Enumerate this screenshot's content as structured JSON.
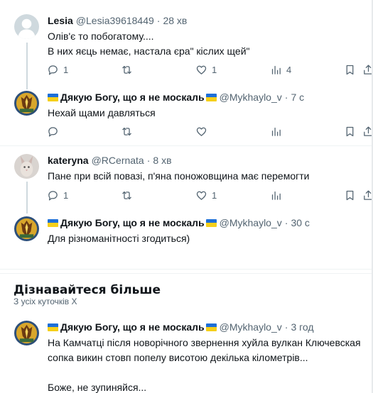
{
  "posts": [
    {
      "name": "Lesia",
      "handle": "@Lesia39618449",
      "time": "28 хв",
      "lines": [
        "Олів'є то побогатому....",
        "В них яєць немає, настала єра\" кіслих щей\""
      ],
      "replies": "1",
      "reposts": "",
      "likes": "1",
      "views": "4"
    },
    {
      "name": "Дякую Богу, що я не москаль",
      "handle": "@Mykhaylo_v",
      "time": "7 с",
      "lines": [
        "Нехай щами давляться"
      ],
      "replies": "",
      "reposts": "",
      "likes": "",
      "views": ""
    },
    {
      "name": "kateryna",
      "handle": "@RCernata",
      "time": "8 хв",
      "lines": [
        "Пане при всій повазі, п'яна поножовщина має перемогти"
      ],
      "replies": "1",
      "reposts": "",
      "likes": "1",
      "views": ""
    },
    {
      "name": "Дякую Богу, що я не москаль",
      "handle": "@Mykhaylo_v",
      "time": "30 с",
      "lines": [
        "Для різноманітності згодиться)"
      ]
    },
    {
      "name": "Дякую Богу, що я не москаль",
      "handle": "@Mykhaylo_v",
      "time": "3 год",
      "lines": [
        "На Камчатці після новорічного звернення хуйла вулкан Ключевская",
        "сопка викин стовп попелу висотою декілька кілометрів...",
        "Боже, не зупиняйся..."
      ]
    }
  ],
  "section": {
    "title": "Дізнавайтеся більше",
    "subtitle": "З усіх куточків X"
  },
  "colors": {
    "flag_blue": "#1d6fd8",
    "flag_yellow": "#f5cf1a",
    "muted": "#536471",
    "divider": "#eff3f4"
  }
}
